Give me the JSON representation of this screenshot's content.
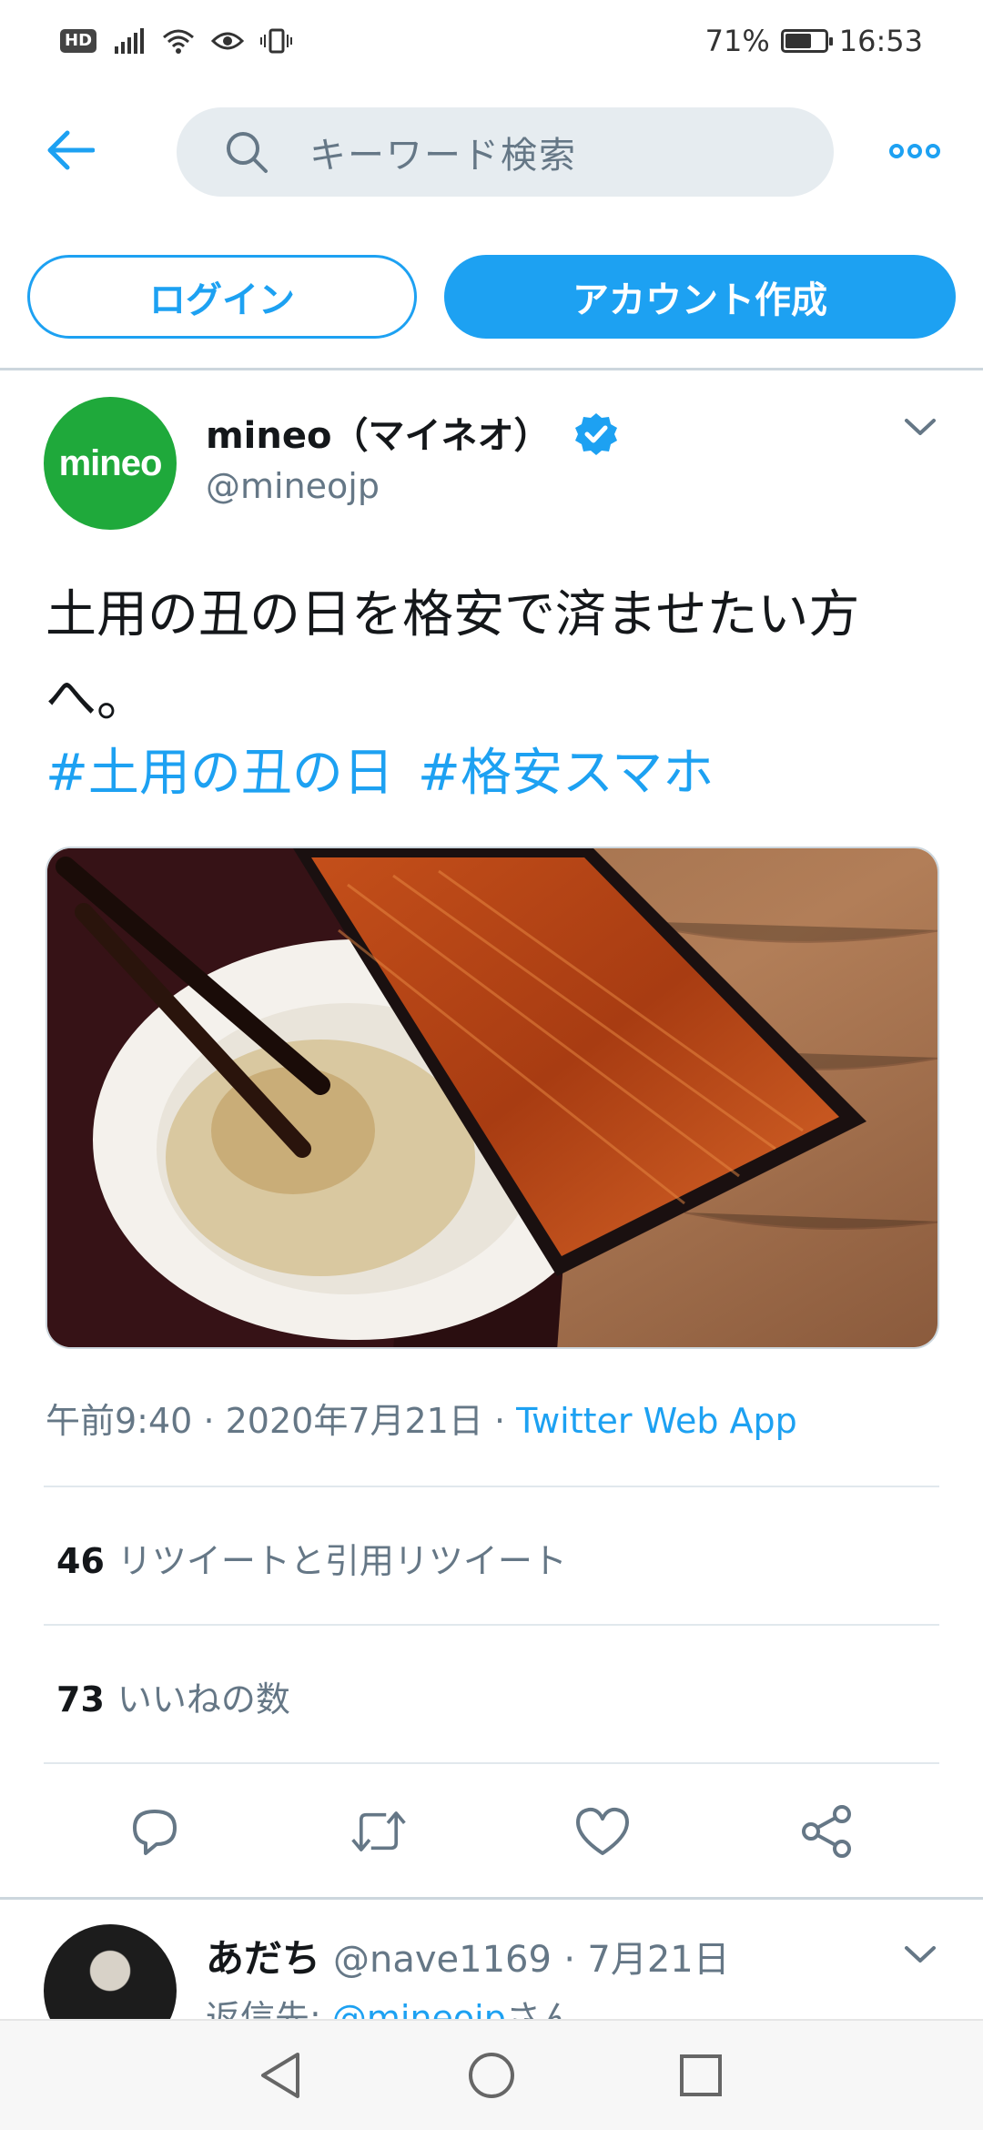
{
  "status_bar": {
    "hd_label": "HD",
    "battery_percent": "71%",
    "battery_level": 0.71,
    "time": "16:53"
  },
  "nav": {
    "search_placeholder": "キーワード検索"
  },
  "auth": {
    "login_label": "ログイン",
    "signup_label": "アカウント作成"
  },
  "tweet": {
    "avatar_text": "mineo",
    "author_name": "mineo（マイネオ）",
    "author_handle": "@mineojp",
    "text": "土用の丑の日を格安で済ませたい方へ。",
    "hashtags": [
      "#土用の丑の日",
      "#格安スマホ"
    ],
    "time": "午前9:40",
    "date": "2020年7月21日",
    "separator": "·",
    "source": "Twitter Web App",
    "retweets_count": "46",
    "retweets_label": "リツイートと引用リツイート",
    "likes_count": "73",
    "likes_label": "いいねの数"
  },
  "reply": {
    "name": "あだち",
    "handle": "@nave1169",
    "date": "7月21日",
    "separator": "·",
    "reply_to_prefix": "返信先: ",
    "reply_to_mention": "@mineojp",
    "reply_to_suffix": "さん"
  },
  "colors": {
    "accent": "#1da1f2",
    "mineo_green": "#1fa93b",
    "muted_text": "#657786"
  },
  "icons": [
    "back-arrow-icon",
    "search-icon",
    "more-options-icon",
    "verified-badge-icon",
    "chevron-down-icon",
    "reply-icon",
    "retweet-icon",
    "like-heart-icon",
    "share-icon",
    "nav-back-icon",
    "nav-home-icon",
    "nav-recents-icon"
  ]
}
